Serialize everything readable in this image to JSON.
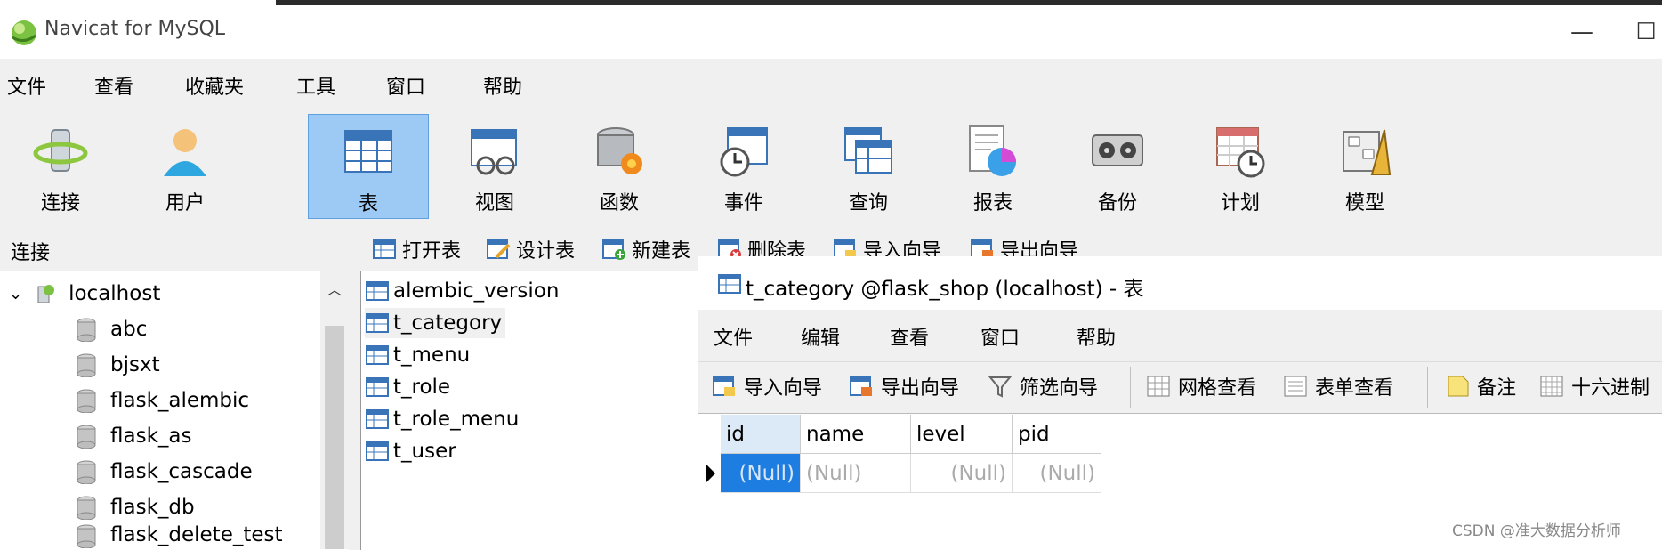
{
  "window": {
    "title": "Navicat for MySQL",
    "controls": {
      "minimize": "—",
      "maximize": "☐",
      "close": "✕"
    }
  },
  "menubar": [
    "文件",
    "查看",
    "收藏夹",
    "工具",
    "窗口",
    "帮助"
  ],
  "toolbar": [
    {
      "label": "连接",
      "icon": "connection-icon"
    },
    {
      "label": "用户",
      "icon": "user-icon"
    },
    {
      "label": "表",
      "icon": "table-icon",
      "active": true
    },
    {
      "label": "视图",
      "icon": "view-icon"
    },
    {
      "label": "函数",
      "icon": "function-icon"
    },
    {
      "label": "事件",
      "icon": "event-icon"
    },
    {
      "label": "查询",
      "icon": "query-icon"
    },
    {
      "label": "报表",
      "icon": "report-icon"
    },
    {
      "label": "备份",
      "icon": "backup-icon"
    },
    {
      "label": "计划",
      "icon": "schedule-icon"
    },
    {
      "label": "模型",
      "icon": "model-icon"
    }
  ],
  "connection_panel": {
    "header": "连接",
    "root": "localhost",
    "databases": [
      "abc",
      "bjsxt",
      "flask_alembic",
      "flask_as",
      "flask_cascade",
      "flask_db",
      "flask_delete_test"
    ]
  },
  "object_toolbar": [
    "打开表",
    "设计表",
    "新建表",
    "删除表",
    "导入向导",
    "导出向导"
  ],
  "tables": [
    "alembic_version",
    "t_category",
    "t_menu",
    "t_role",
    "t_role_menu",
    "t_user"
  ],
  "selected_table": "t_category",
  "table_window": {
    "title": "t_category @flask_shop (localhost) - 表",
    "menu": [
      "文件",
      "编辑",
      "查看",
      "窗口",
      "帮助"
    ],
    "toolbar": [
      "导入向导",
      "导出向导",
      "筛选向导",
      "网格查看",
      "表单查看",
      "备注",
      "十六进制"
    ],
    "grid": {
      "columns": [
        "id",
        "name",
        "level",
        "pid"
      ],
      "rows": [
        [
          "(Null)",
          "(Null)",
          "(Null)",
          "(Null)"
        ]
      ]
    }
  },
  "watermark": "CSDN @准大数据分析师"
}
